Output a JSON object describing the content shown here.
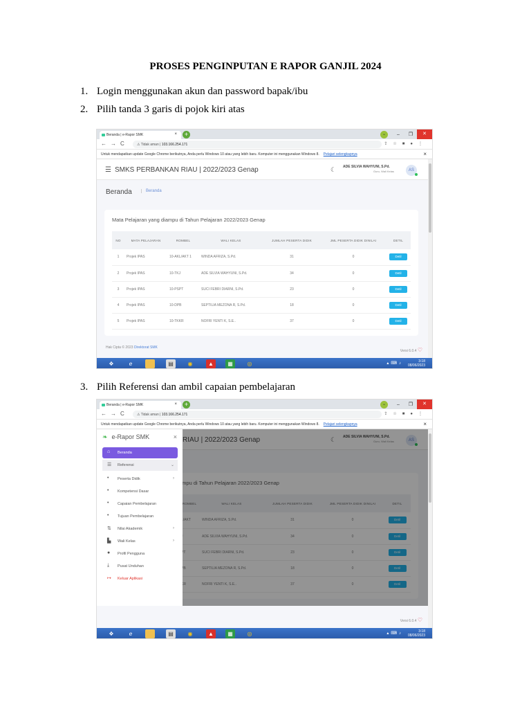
{
  "doc_title": "PROSES PENGINPUTAN E RAPOR GANJIL 2024",
  "steps": [
    {
      "num": "1.",
      "text": "Login menggunakan akun dan password bapak/ibu"
    },
    {
      "num": "2.",
      "text": "Pilih tanda 3 garis di pojok kiri atas"
    },
    {
      "num": "3.",
      "text": "Pilih Referensi dan ambil capaian pembelajaran"
    }
  ],
  "browser": {
    "tab_title": "Beranda | e-Rapor SMK",
    "new_tab": "+",
    "insecure": "Tidak aman",
    "url": "103.166.254.171",
    "infobar": "Untuk mendapatkan update Google Chrome berikutnya, Anda perlu Windows 10 atau yang lebih baru. Komputer ini menggunakan Windows 8.",
    "infobar_link": "Pelajari selengkapnya"
  },
  "app": {
    "school": "SMKS PERBANKAN RIAU | 2022/2023 Genap",
    "school_partial": "RIAU | 2022/2023 Genap",
    "user_name": "ADE SILVIA WAHYUNI, S.Pd.",
    "user_role": "Guru, Wali Kelas",
    "avatar": "AS",
    "page_title": "Beranda",
    "breadcrumb": "Beranda",
    "card_title": "Mata Pelajaran yang diampu di Tahun Pelajaran 2022/2023 Genap",
    "card_title_partial": "ampu di Tahun Pelajaran 2022/2023 Genap",
    "columns": [
      "NO",
      "MATA PELAJARAN",
      "ROMBEL",
      "WALI KELAS",
      "JUMLAH PESERTA DIDIK",
      "JML PESERTA DIDIK DINILAI",
      "DETIL"
    ],
    "columns_partial": [
      "ROMBEL",
      "WALI KELAS",
      "JUMLAH PESERTA DIDIK",
      "JML PESERTA DIDIK DINILAI",
      "DETIL"
    ],
    "rows": [
      {
        "no": "1",
        "mapel": "Projek IPAS",
        "rombel": "10-AKL/AKT 1",
        "rombel_partial": "L/AKT",
        "wali": "WINDA AFRIZA, S.Pd.",
        "jumlah": "31",
        "dinilai": "0"
      },
      {
        "no": "2",
        "mapel": "Projek IPAS",
        "rombel": "10-TKJ",
        "rombel_partial": "J",
        "wali": "ADE SILVIA WAHYUNI, S.Pd.",
        "jumlah": "34",
        "dinilai": "0"
      },
      {
        "no": "3",
        "mapel": "Projek IPAS",
        "rombel": "10-PSPT",
        "rombel_partial": "PT",
        "wali": "SUCI FEBRI DIARNI, S.Pd.",
        "jumlah": "23",
        "dinilai": "0"
      },
      {
        "no": "4",
        "mapel": "Projek IPAS",
        "rombel": "10-DPB",
        "rombel_partial": "PB",
        "wali": "SEPTILIA MEZONA R, S.Pd.",
        "jumlah": "18",
        "dinilai": "0"
      },
      {
        "no": "5",
        "mapel": "Projek IPAS",
        "rombel": "10-TKKR",
        "rombel_partial": "KR",
        "wali": "NOFRI YENTI K, S.E..",
        "jumlah": "37",
        "dinilai": "0"
      }
    ],
    "detil_label": "Detil",
    "copyright": "Hak Cipta © 2023",
    "copyright_link": "Direktorat SMK",
    "version": "Versi 6.0.4"
  },
  "sidebar": {
    "logo": "e-Rapor SMK",
    "close": "×",
    "items": [
      {
        "label": "Beranda",
        "icon": "home-icon"
      },
      {
        "label": "Referensi",
        "icon": "list-icon"
      },
      {
        "label": "Peserta Didik",
        "icon": "dot-icon"
      },
      {
        "label": "Kompetensi Dasar",
        "icon": "dot-icon"
      },
      {
        "label": "Capaian Pembelajaran",
        "icon": "dot-icon"
      },
      {
        "label": "Tujuan Pembelajaran",
        "icon": "dot-icon"
      },
      {
        "label": "Nilai Akademik",
        "icon": "sort-icon"
      },
      {
        "label": "Wali Kelas",
        "icon": "users-icon"
      },
      {
        "label": "Profil Pengguna",
        "icon": "user-icon"
      },
      {
        "label": "Pusat Unduhan",
        "icon": "download-icon"
      },
      {
        "label": "Keluar Aplikasi",
        "icon": "logout-icon"
      }
    ]
  },
  "taskbar": {
    "time": "3:18",
    "date": "08/06/2023",
    "icons": [
      "windows-icon",
      "ie-icon",
      "explorer-icon",
      "app-icon",
      "chrome-icon",
      "acrobat-icon",
      "excel-icon",
      "chrome-search-icon"
    ]
  }
}
